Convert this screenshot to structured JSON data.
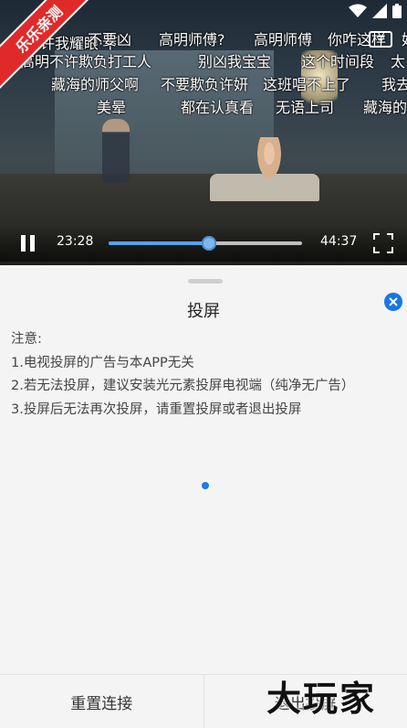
{
  "video": {
    "danmaku": [
      {
        "text": "许我耀眼·下"
      },
      {
        "text": "不要凶"
      },
      {
        "text": "高明师傅?"
      },
      {
        "text": "高明师傅"
      },
      {
        "text": "你咋这样"
      },
      {
        "text": "好"
      },
      {
        "text": "高明不许欺负打工人"
      },
      {
        "text": "别凶我宝宝"
      },
      {
        "text": "这个时间段"
      },
      {
        "text": "太"
      },
      {
        "text": "藏海的师父啊"
      },
      {
        "text": "不要欺负许妍"
      },
      {
        "text": "这班唱不上了"
      },
      {
        "text": "我去"
      },
      {
        "text": "美晕"
      },
      {
        "text": "都在认真看"
      },
      {
        "text": "无语上司"
      },
      {
        "text": "藏海的"
      }
    ],
    "banner_label": "乐乐亲测",
    "current_time": "23:28",
    "total_time": "44:37",
    "progress": 0.52,
    "accent_color": "#5aa0e8"
  },
  "sheet": {
    "title": "投屏",
    "notes": [
      "注意:",
      "1.电视投屏的广告与本APP无关",
      "2.若无法投屏，建议安装光元素投屏电视端（纯净无广告）",
      "3.投屏后无法再次投屏，请重置投屏或者退出投屏"
    ],
    "reset_label": "重置连接",
    "exit_label": "退出投屏"
  },
  "watermark": "大玩家",
  "icons": {
    "close": "close-icon",
    "pause": "pause-icon",
    "fullscreen": "fullscreen-icon",
    "cast": "cast-icon",
    "wifi": "wifi-icon",
    "signal": "signal-icon",
    "battery": "battery-icon"
  }
}
